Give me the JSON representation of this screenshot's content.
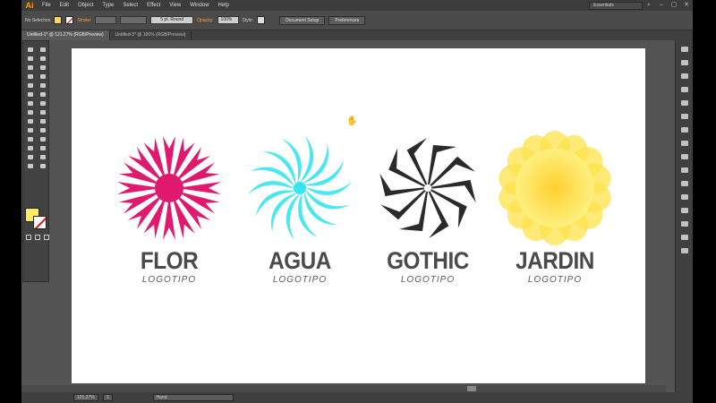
{
  "app": {
    "logo": "Ai",
    "workspace": "Essentials"
  },
  "menu": [
    "File",
    "Edit",
    "Object",
    "Type",
    "Select",
    "Effect",
    "View",
    "Window",
    "Help"
  ],
  "controlbar": {
    "selection": "No Selection",
    "stroke_label": "Stroke:",
    "stroke_weight": "",
    "brush": "5 pt. Round",
    "opacity_label": "Opacity:",
    "opacity": "100%",
    "style_label": "Style:",
    "doc_setup": "Document Setup",
    "preferences": "Preferences"
  },
  "tabs": [
    "Untitled-1* @ 121.27% (RGB/Preview)",
    "Untitled-3* @ 100% (RGB/Preview)"
  ],
  "logos": [
    {
      "title": "FLOR",
      "subtitle": "LOGOTIPO",
      "color": "#e0186e",
      "icon": "flower-star-icon"
    },
    {
      "title": "AGUA",
      "subtitle": "LOGOTIPO",
      "color": "#35e6ee",
      "icon": "water-swirl-icon"
    },
    {
      "title": "GOTHIC",
      "subtitle": "LOGOTIPO",
      "color": "#2a2a2a",
      "icon": "gothic-spike-icon"
    },
    {
      "title": "JARDIN",
      "subtitle": "LOGOTIPO",
      "color": "#ffe14a",
      "icon": "sunflower-icon"
    }
  ],
  "statusbar": {
    "zoom": "121.27%",
    "artboard": "1",
    "tool": "Hand"
  }
}
